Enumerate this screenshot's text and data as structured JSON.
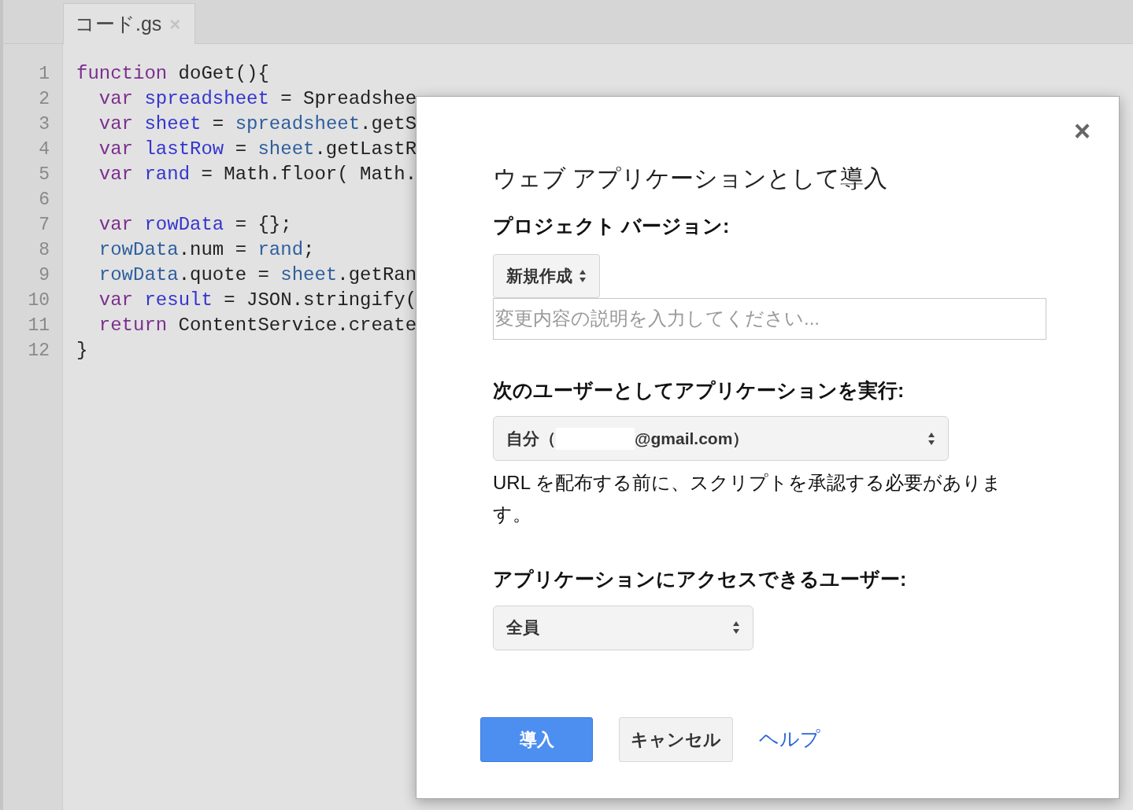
{
  "editor": {
    "tab": {
      "label": "コード.gs",
      "close": "×"
    },
    "lines": [
      {
        "number": "1",
        "tokens": [
          {
            "text": "function",
            "kind": "keyword"
          },
          {
            "text": " doGet(){",
            "kind": "plain"
          }
        ]
      },
      {
        "number": "2",
        "tokens": [
          {
            "text": "  var",
            "kind": "keyword"
          },
          {
            "text": " spreadsheet",
            "kind": "variable"
          },
          {
            "text": " = Spreadshee",
            "kind": "plain"
          }
        ]
      },
      {
        "number": "3",
        "tokens": [
          {
            "text": "  var",
            "kind": "keyword"
          },
          {
            "text": " sheet",
            "kind": "variable"
          },
          {
            "text": " = ",
            "kind": "plain"
          },
          {
            "text": "spreadsheet",
            "kind": "property"
          },
          {
            "text": ".getS",
            "kind": "plain"
          }
        ]
      },
      {
        "number": "4",
        "tokens": [
          {
            "text": "  var",
            "kind": "keyword"
          },
          {
            "text": " lastRow",
            "kind": "variable"
          },
          {
            "text": " = ",
            "kind": "plain"
          },
          {
            "text": "sheet",
            "kind": "property"
          },
          {
            "text": ".getLastR",
            "kind": "plain"
          }
        ]
      },
      {
        "number": "5",
        "tokens": [
          {
            "text": "  var",
            "kind": "keyword"
          },
          {
            "text": " rand",
            "kind": "variable"
          },
          {
            "text": " = Math.floor( Math.",
            "kind": "plain"
          }
        ]
      },
      {
        "number": "6"
      },
      {
        "number": "7",
        "tokens": [
          {
            "text": "  var",
            "kind": "keyword"
          },
          {
            "text": " rowData",
            "kind": "variable"
          },
          {
            "text": " = {};",
            "kind": "plain"
          }
        ]
      },
      {
        "number": "8",
        "tokens": [
          {
            "text": "  rowData",
            "kind": "property"
          },
          {
            "text": ".num = ",
            "kind": "plain"
          },
          {
            "text": "rand",
            "kind": "property"
          },
          {
            "text": ";",
            "kind": "plain"
          }
        ]
      },
      {
        "number": "9",
        "tokens": [
          {
            "text": "  rowData",
            "kind": "property"
          },
          {
            "text": ".quote = ",
            "kind": "plain"
          },
          {
            "text": "sheet",
            "kind": "property"
          },
          {
            "text": ".getRan",
            "kind": "plain"
          }
        ]
      },
      {
        "number": "10",
        "tokens": [
          {
            "text": "  var",
            "kind": "keyword"
          },
          {
            "text": " result",
            "kind": "variable"
          },
          {
            "text": " = JSON.stringify(",
            "kind": "plain"
          }
        ]
      },
      {
        "number": "11",
        "tokens": [
          {
            "text": "  return",
            "kind": "keyword"
          },
          {
            "text": " ContentService.create",
            "kind": "plain"
          }
        ]
      },
      {
        "number": "12",
        "tokens": [
          {
            "text": "}",
            "kind": "plain"
          }
        ]
      }
    ]
  },
  "dialog": {
    "close": "×",
    "title": "ウェブ アプリケーションとして導入",
    "version_label": "プロジェクト バージョン:",
    "version_select": "新規作成",
    "description_field": {
      "placeholder": "変更内容の説明を入力してください..."
    },
    "execute_label": "次のユーザーとしてアプリケーションを実行:",
    "execute_select": {
      "value_prefix": "自分（",
      "value_suffix": "@gmail.com）"
    },
    "note": "URL を配布する前に、スクリプトを承認する必要があります。",
    "access_label": "アプリケーションにアクセスできるユーザー:",
    "access_select": "全員",
    "buttons": {
      "deploy": "導入",
      "cancel": "キャンセル",
      "help": "ヘルプ"
    }
  }
}
